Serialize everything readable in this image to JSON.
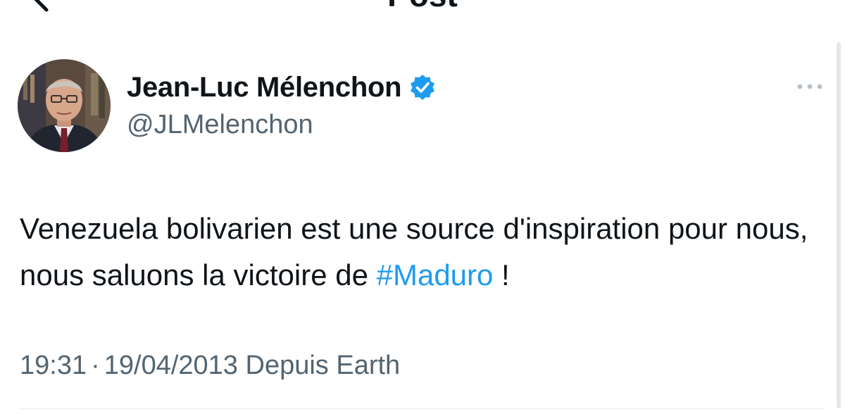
{
  "header": {
    "title": "Post"
  },
  "author": {
    "display_name": "Jean-Luc Mélenchon",
    "handle": "@JLMelenchon",
    "verified": true
  },
  "tweet": {
    "text_before": "Venezuela bolivarien est une source d'inspiration pour nous, nous saluons la victoire de ",
    "hashtag": "#Maduro",
    "text_after": " !"
  },
  "meta": {
    "time": "19:31",
    "separator": "·",
    "date": "19/04/2013",
    "source": "Depuis Earth"
  },
  "icons": {
    "back": "arrow-left-icon",
    "verified": "verified-badge-icon",
    "more": "more-horizontal-icon"
  },
  "colors": {
    "accent": "#1d9bf0",
    "text": "#0f1419",
    "secondary_text": "#536471"
  }
}
